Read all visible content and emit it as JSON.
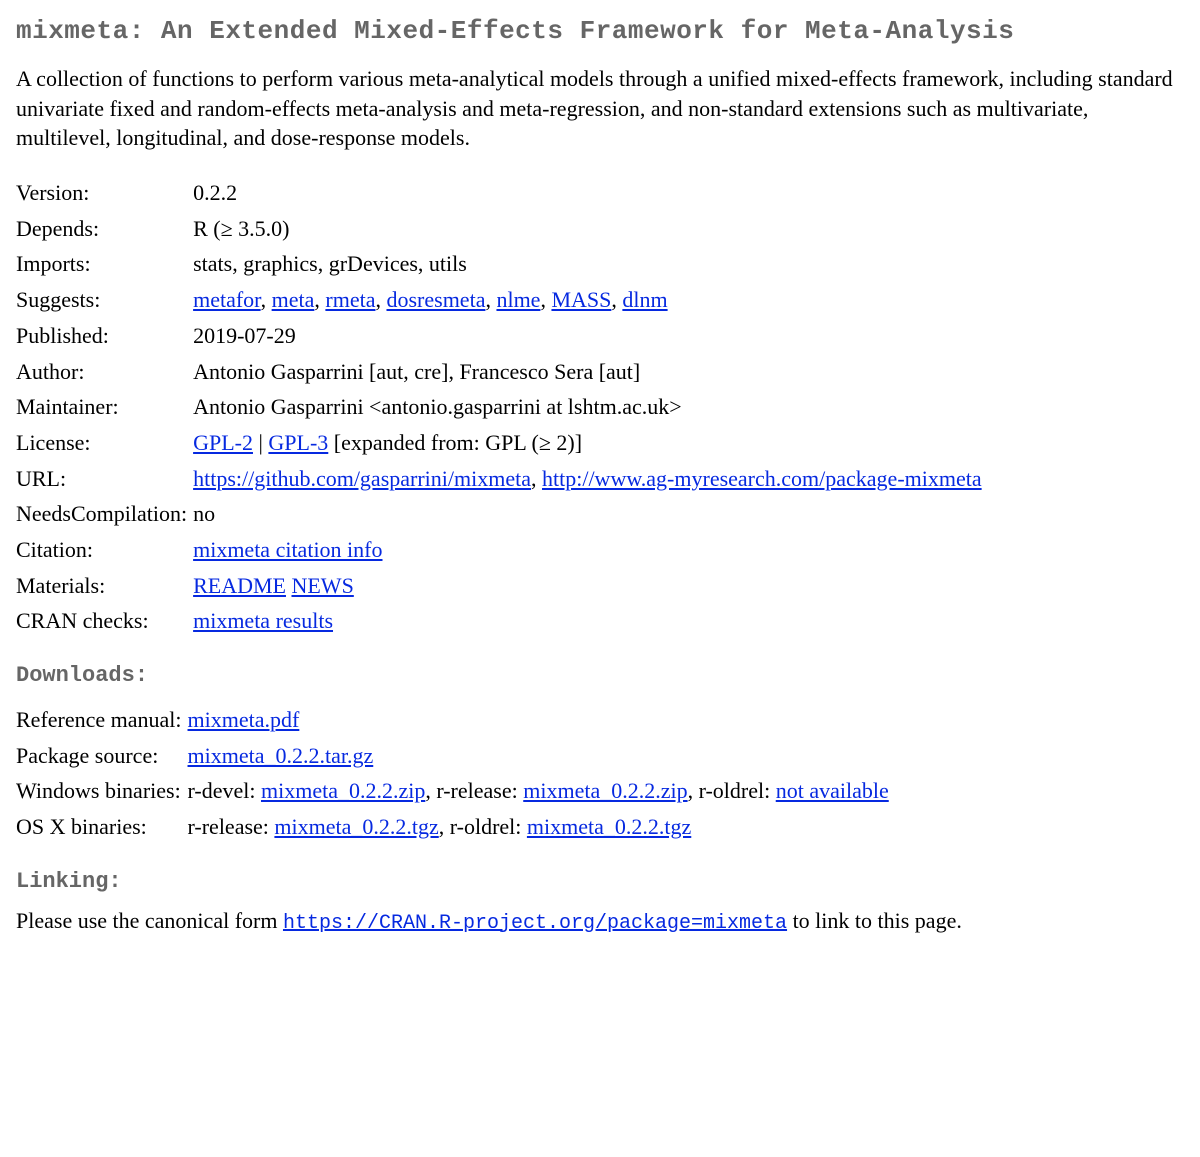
{
  "title": "mixmeta: An Extended Mixed-Effects Framework for Meta-Analysis",
  "description": "A collection of functions to perform various meta-analytical models through a unified mixed-effects framework, including standard univariate fixed and random-effects meta-analysis and meta-regression, and non-standard extensions such as multivariate, multilevel, longitudinal, and dose-response models.",
  "meta": {
    "version_k": "Version:",
    "version_v": "0.2.2",
    "depends_k": "Depends:",
    "depends_v": "R (≥ 3.5.0)",
    "imports_k": "Imports:",
    "imports_v": "stats, graphics, grDevices, utils",
    "suggests_k": "Suggests:",
    "suggests": [
      "metafor",
      "meta",
      "rmeta",
      "dosresmeta",
      "nlme",
      "MASS",
      "dlnm"
    ],
    "published_k": "Published:",
    "published_v": "2019-07-29",
    "author_k": "Author:",
    "author_v": "Antonio Gasparrini [aut, cre], Francesco Sera [aut]",
    "maintainer_k": "Maintainer:",
    "maintainer_v": "Antonio Gasparrini <antonio.gasparrini at lshtm.ac.uk>",
    "license_k": "License:",
    "license_links": [
      "GPL-2",
      "GPL-3"
    ],
    "license_sep": " | ",
    "license_tail": " [expanded from: GPL (≥ 2)]",
    "url_k": "URL:",
    "url_links": [
      "https://github.com/gasparrini/mixmeta",
      "http://www.ag-myresearch.com/package-mixmeta"
    ],
    "needscomp_k": "NeedsCompilation:",
    "needscomp_v": "no",
    "citation_k": "Citation:",
    "citation_link": "mixmeta citation info",
    "materials_k": "Materials:",
    "materials_links": [
      "README",
      "NEWS"
    ],
    "checks_k": "CRAN checks:",
    "checks_link": "mixmeta results"
  },
  "downloads_h": "Downloads:",
  "downloads": {
    "refman_k": "Reference manual:",
    "refman_link": "mixmeta.pdf",
    "src_k": "Package source:",
    "src_link": "mixmeta_0.2.2.tar.gz",
    "win_k": "Windows binaries:",
    "win_pre_devel": "r-devel: ",
    "win_devel_link": "mixmeta_0.2.2.zip",
    "win_pre_rel": ", r-release: ",
    "win_rel_link": "mixmeta_0.2.2.zip",
    "win_pre_old": ", r-oldrel: ",
    "win_old_link": "not available",
    "osx_k": "OS X binaries:",
    "osx_pre_rel": "r-release: ",
    "osx_rel_link": "mixmeta_0.2.2.tgz",
    "osx_pre_old": ", r-oldrel: ",
    "osx_old_link": "mixmeta_0.2.2.tgz"
  },
  "linking_h": "Linking:",
  "linking_pre": "Please use the canonical form ",
  "linking_url": "https://CRAN.R-project.org/package=mixmeta",
  "linking_post": " to link to this page."
}
